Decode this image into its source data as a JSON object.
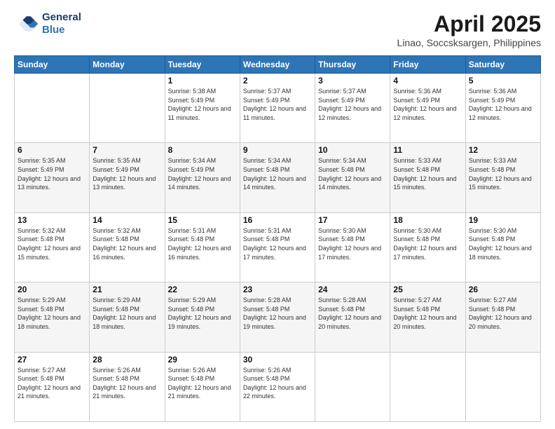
{
  "header": {
    "logo_line1": "General",
    "logo_line2": "Blue",
    "month": "April 2025",
    "location": "Linao, Soccsksargen, Philippines"
  },
  "days_of_week": [
    "Sunday",
    "Monday",
    "Tuesday",
    "Wednesday",
    "Thursday",
    "Friday",
    "Saturday"
  ],
  "weeks": [
    [
      {
        "day": "",
        "info": ""
      },
      {
        "day": "",
        "info": ""
      },
      {
        "day": "1",
        "info": "Sunrise: 5:38 AM\nSunset: 5:49 PM\nDaylight: 12 hours and 11 minutes."
      },
      {
        "day": "2",
        "info": "Sunrise: 5:37 AM\nSunset: 5:49 PM\nDaylight: 12 hours and 11 minutes."
      },
      {
        "day": "3",
        "info": "Sunrise: 5:37 AM\nSunset: 5:49 PM\nDaylight: 12 hours and 12 minutes."
      },
      {
        "day": "4",
        "info": "Sunrise: 5:36 AM\nSunset: 5:49 PM\nDaylight: 12 hours and 12 minutes."
      },
      {
        "day": "5",
        "info": "Sunrise: 5:36 AM\nSunset: 5:49 PM\nDaylight: 12 hours and 12 minutes."
      }
    ],
    [
      {
        "day": "6",
        "info": "Sunrise: 5:35 AM\nSunset: 5:49 PM\nDaylight: 12 hours and 13 minutes."
      },
      {
        "day": "7",
        "info": "Sunrise: 5:35 AM\nSunset: 5:49 PM\nDaylight: 12 hours and 13 minutes."
      },
      {
        "day": "8",
        "info": "Sunrise: 5:34 AM\nSunset: 5:49 PM\nDaylight: 12 hours and 14 minutes."
      },
      {
        "day": "9",
        "info": "Sunrise: 5:34 AM\nSunset: 5:48 PM\nDaylight: 12 hours and 14 minutes."
      },
      {
        "day": "10",
        "info": "Sunrise: 5:34 AM\nSunset: 5:48 PM\nDaylight: 12 hours and 14 minutes."
      },
      {
        "day": "11",
        "info": "Sunrise: 5:33 AM\nSunset: 5:48 PM\nDaylight: 12 hours and 15 minutes."
      },
      {
        "day": "12",
        "info": "Sunrise: 5:33 AM\nSunset: 5:48 PM\nDaylight: 12 hours and 15 minutes."
      }
    ],
    [
      {
        "day": "13",
        "info": "Sunrise: 5:32 AM\nSunset: 5:48 PM\nDaylight: 12 hours and 15 minutes."
      },
      {
        "day": "14",
        "info": "Sunrise: 5:32 AM\nSunset: 5:48 PM\nDaylight: 12 hours and 16 minutes."
      },
      {
        "day": "15",
        "info": "Sunrise: 5:31 AM\nSunset: 5:48 PM\nDaylight: 12 hours and 16 minutes."
      },
      {
        "day": "16",
        "info": "Sunrise: 5:31 AM\nSunset: 5:48 PM\nDaylight: 12 hours and 17 minutes."
      },
      {
        "day": "17",
        "info": "Sunrise: 5:30 AM\nSunset: 5:48 PM\nDaylight: 12 hours and 17 minutes."
      },
      {
        "day": "18",
        "info": "Sunrise: 5:30 AM\nSunset: 5:48 PM\nDaylight: 12 hours and 17 minutes."
      },
      {
        "day": "19",
        "info": "Sunrise: 5:30 AM\nSunset: 5:48 PM\nDaylight: 12 hours and 18 minutes."
      }
    ],
    [
      {
        "day": "20",
        "info": "Sunrise: 5:29 AM\nSunset: 5:48 PM\nDaylight: 12 hours and 18 minutes."
      },
      {
        "day": "21",
        "info": "Sunrise: 5:29 AM\nSunset: 5:48 PM\nDaylight: 12 hours and 18 minutes."
      },
      {
        "day": "22",
        "info": "Sunrise: 5:29 AM\nSunset: 5:48 PM\nDaylight: 12 hours and 19 minutes."
      },
      {
        "day": "23",
        "info": "Sunrise: 5:28 AM\nSunset: 5:48 PM\nDaylight: 12 hours and 19 minutes."
      },
      {
        "day": "24",
        "info": "Sunrise: 5:28 AM\nSunset: 5:48 PM\nDaylight: 12 hours and 20 minutes."
      },
      {
        "day": "25",
        "info": "Sunrise: 5:27 AM\nSunset: 5:48 PM\nDaylight: 12 hours and 20 minutes."
      },
      {
        "day": "26",
        "info": "Sunrise: 5:27 AM\nSunset: 5:48 PM\nDaylight: 12 hours and 20 minutes."
      }
    ],
    [
      {
        "day": "27",
        "info": "Sunrise: 5:27 AM\nSunset: 5:48 PM\nDaylight: 12 hours and 21 minutes."
      },
      {
        "day": "28",
        "info": "Sunrise: 5:26 AM\nSunset: 5:48 PM\nDaylight: 12 hours and 21 minutes."
      },
      {
        "day": "29",
        "info": "Sunrise: 5:26 AM\nSunset: 5:48 PM\nDaylight: 12 hours and 21 minutes."
      },
      {
        "day": "30",
        "info": "Sunrise: 5:26 AM\nSunset: 5:48 PM\nDaylight: 12 hours and 22 minutes."
      },
      {
        "day": "",
        "info": ""
      },
      {
        "day": "",
        "info": ""
      },
      {
        "day": "",
        "info": ""
      }
    ]
  ]
}
